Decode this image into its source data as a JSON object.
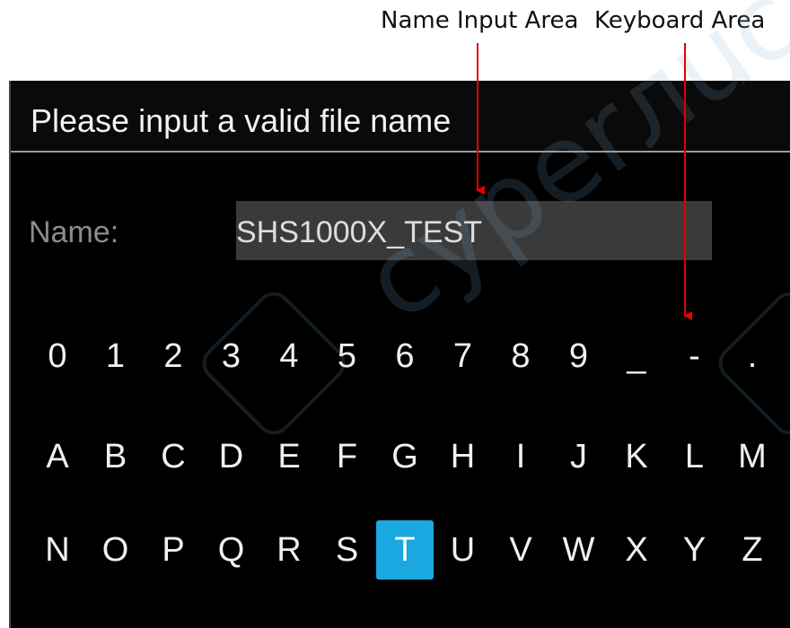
{
  "annotations": {
    "name_input_area": "Name Input Area",
    "keyboard_area": "Keyboard Area",
    "arrow_color": "#e00000"
  },
  "dialog": {
    "title": "Please input a valid file name",
    "name_label": "Name:",
    "name_value": "SHS1000X_TEST"
  },
  "keyboard": {
    "selected_key": "T",
    "selected_color": "#1ba7e0",
    "rows": [
      [
        "0",
        "1",
        "2",
        "3",
        "4",
        "5",
        "6",
        "7",
        "8",
        "9",
        "_",
        "-",
        "."
      ],
      [
        "A",
        "B",
        "C",
        "D",
        "E",
        "F",
        "G",
        "H",
        "I",
        "J",
        "K",
        "L",
        "M"
      ],
      [
        "N",
        "O",
        "P",
        "Q",
        "R",
        "S",
        "T",
        "U",
        "V",
        "W",
        "X",
        "Y",
        "Z"
      ]
    ]
  }
}
